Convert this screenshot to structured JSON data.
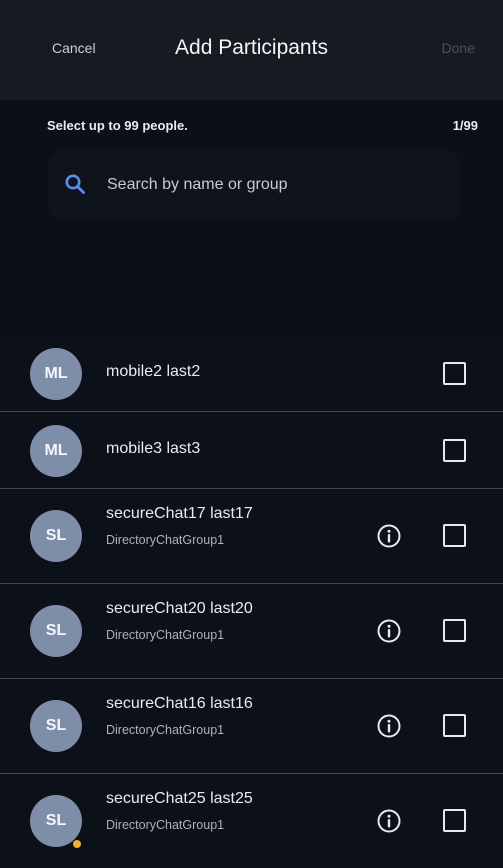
{
  "header": {
    "cancel_label": "Cancel",
    "title": "Add Participants",
    "done_label": "Done"
  },
  "subheader": {
    "hint": "Select up to 99 people.",
    "count": "1/99"
  },
  "search": {
    "placeholder": "Search by name or group",
    "value": ""
  },
  "participants": [
    {
      "initials": "ML",
      "name": "mobile2 last2",
      "group": "",
      "has_info": false,
      "checked": false
    },
    {
      "initials": "ML",
      "name": "mobile3 last3",
      "group": "",
      "has_info": false,
      "checked": false
    },
    {
      "initials": "SL",
      "name": "secureChat17 last17",
      "group": "DirectoryChatGroup1",
      "has_info": true,
      "checked": false
    },
    {
      "initials": "SL",
      "name": "secureChat20 last20",
      "group": "DirectoryChatGroup1",
      "has_info": true,
      "checked": false
    },
    {
      "initials": "SL",
      "name": "secureChat16 last16",
      "group": "DirectoryChatGroup1",
      "has_info": true,
      "checked": false
    },
    {
      "initials": "SL",
      "name": "secureChat25 last25",
      "group": "DirectoryChatGroup1",
      "has_info": true,
      "checked": false,
      "presence": "away"
    }
  ],
  "icons": {
    "search": "search-icon",
    "info": "info-icon",
    "checkbox": "checkbox-icon"
  },
  "colors": {
    "accent": "#5b8def",
    "presence_away": "#f0b030",
    "avatar": "#7f8ea8"
  }
}
